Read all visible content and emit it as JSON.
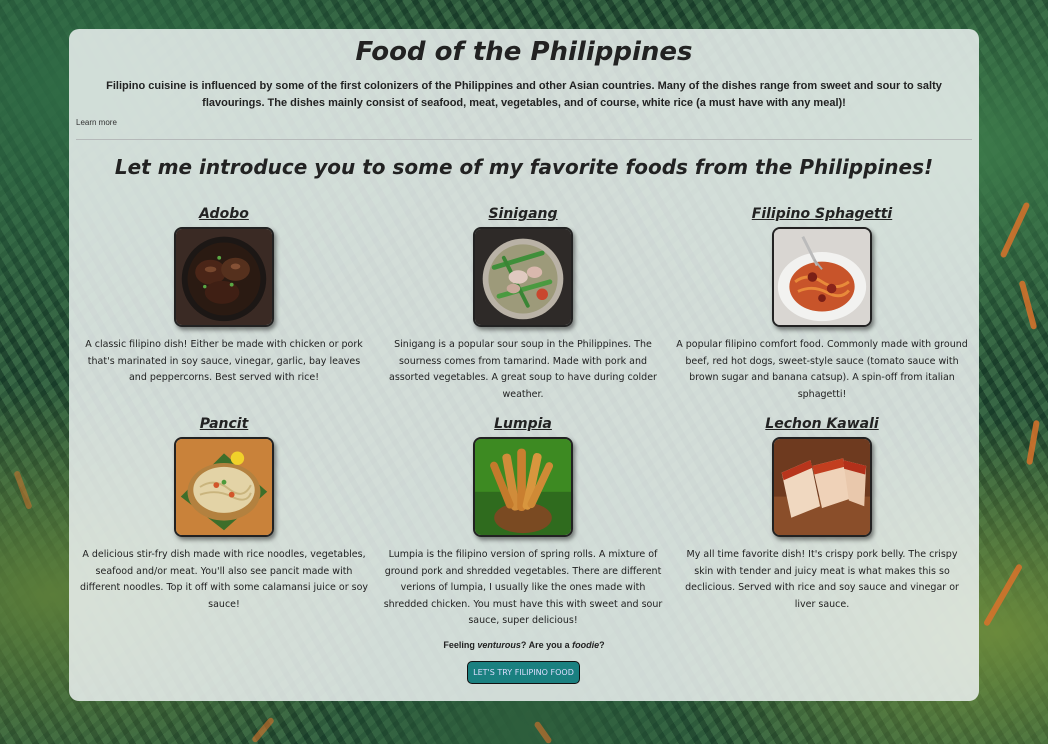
{
  "header": {
    "title": "Food of the Philippines",
    "intro": "Filipino cuisine is influenced by some of the first colonizers of the Philippines and other Asian countries. Many of the dishes range from sweet and sour to salty flavourings. The dishes mainly consist of seafood, meat, vegetables, and of course, white rice (a must have with any meal)!",
    "learn_more": "Learn more"
  },
  "main": {
    "subtitle": "Let me introduce you to some of my favorite foods from the Philippines!",
    "foods": [
      {
        "name": "Adobo",
        "description": "A classic filipino dish! Either be made with chicken or pork that's marinated in soy sauce, vinegar, garlic, bay leaves and peppercorns. Best served with rice!"
      },
      {
        "name": "Sinigang",
        "description": "Sinigang is a popular sour soup in the Philippines. The sourness comes from tamarind. Made with pork and assorted vegetables. A great soup to have during colder weather."
      },
      {
        "name": "Filipino Sphagetti",
        "description": "A popular filipino comfort food. Commonly made with ground beef, red hot dogs, sweet-style sauce (tomato sauce with brown sugar and banana catsup). A spin-off from italian sphagetti!"
      },
      {
        "name": "Pancit",
        "description": "A delicious stir-fry dish made with rice noodles, vegetables, seafood and/or meat. You'll also see pancit made with different noodles. Top it off with some calamansi juice or soy sauce!"
      },
      {
        "name": "Lumpia",
        "description": "Lumpia is the filipino version of spring rolls. A mixture of ground pork and shredded vegetables. There are different verions of lumpia, I usually like the ones made with shredded chicken. You must have this with sweet and sour sauce, super delicious!"
      },
      {
        "name": "Lechon Kawali",
        "description": "My all time favorite dish! It's crispy pork belly. The crispy skin with tender and juicy meat is what makes this so declicious. Served with rice and soy sauce and vinegar or liver sauce."
      }
    ]
  },
  "cta": {
    "text_1": "Feeling ",
    "text_em_1": "venturous",
    "text_2": "? Are you a ",
    "text_em_2": "foodie",
    "text_3": "?",
    "button_label": "LET'S TRY FILIPINO FOOD"
  },
  "colors": {
    "card_background": "#ecf1f1",
    "button_background": "#1a8080",
    "text": "#222222"
  }
}
